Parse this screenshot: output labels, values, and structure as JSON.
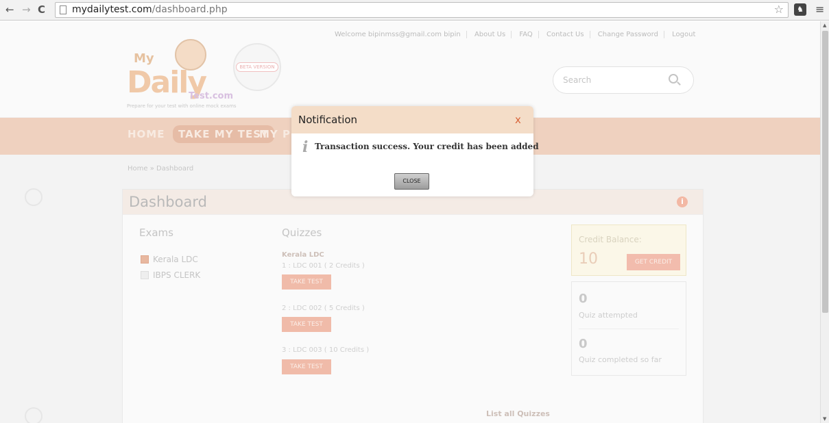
{
  "browser": {
    "url_domain": "mydailytest.com",
    "url_path": "/dashboard.php",
    "back_glyph": "←",
    "forward_glyph": "→",
    "reload_glyph": "C",
    "star_glyph": "☆",
    "menu_glyph": "≡"
  },
  "header": {
    "top_links": [
      "Welcome bipinmss@gmail.com bipin",
      "About Us",
      "FAQ",
      "Contact Us",
      "Change Password",
      "Logout"
    ],
    "logo": {
      "my": "My",
      "daily": "Daily",
      "testcom": "Test.com",
      "tagline": "Prepare for your test with online mock exams",
      "badge": "BETA VERSION"
    },
    "search_placeholder": "Search"
  },
  "nav": {
    "home": "HOME",
    "take_my_test": "TAKE MY TEST",
    "my_partial": "MY PR"
  },
  "breadcrumb": "Home » Dashboard",
  "dashboard": {
    "title": "Dashboard",
    "info_glyph": "i",
    "exams_heading": "Exams",
    "exams": [
      {
        "label": "Kerala LDC",
        "checked": true
      },
      {
        "label": "IBPS CLERK",
        "checked": false
      }
    ],
    "quizzes_heading": "Quizzes",
    "quiz_group": "Kerala LDC",
    "quizzes": [
      {
        "label": "1 : LDC 001 ( 2 Credits )",
        "button": "TAKE TEST"
      },
      {
        "label": "2 : LDC 002 ( 5 Credits )",
        "button": "TAKE TEST"
      },
      {
        "label": "3 : LDC 003 ( 10 Credits )",
        "button": "TAKE TEST"
      }
    ],
    "list_all": "List all Quizzes",
    "credit_label": "Credit Balance:",
    "credit_value": "10",
    "get_credit": "GET CREDIT",
    "quiz_attempted_value": "0",
    "quiz_attempted_label": "Quiz attempted",
    "quiz_completed_value": "0",
    "quiz_completed_label": "Quiz completed so far"
  },
  "modal": {
    "title": "Notification",
    "close_x": "x",
    "info_glyph": "i",
    "message": "Transaction success. Your credit has been added",
    "close_button": "CLOSE"
  },
  "colors": {
    "nav_bar": "#efd1bf",
    "modal_header": "#f4ddc8",
    "modal_close_x": "#d8643a",
    "take_test_button": "#f0bba9"
  }
}
